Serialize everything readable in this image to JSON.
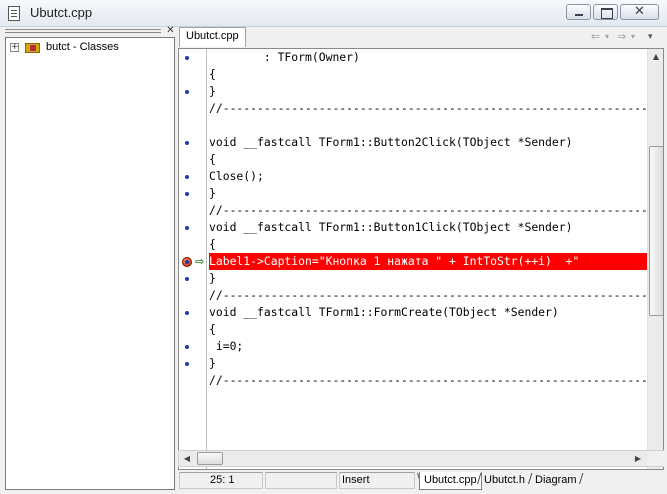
{
  "window": {
    "title": "Ubutct.cpp"
  },
  "class_explorer": {
    "close_glyph": "✕",
    "tree": [
      {
        "expander": "+",
        "label": "butct - Classes"
      }
    ]
  },
  "editor": {
    "tab_label": "Ubutct.cpp",
    "nav": {
      "back": "⇐",
      "back_drop": "▾",
      "forward": "⇒",
      "forward_drop": "▾",
      "menu": "▾"
    },
    "lines": [
      "        : TForm(Owner)",
      "{",
      "}",
      "//---------------------------------------------------------------------",
      "",
      "void __fastcall TForm1::Button2Click(TObject *Sender)",
      "{",
      "Close();",
      "}",
      "//---------------------------------------------------------------------",
      "void __fastcall TForm1::Button1Click(TObject *Sender)",
      "{",
      "Label1->Caption=\"Кнопка 1 нажата \" + IntToStr(++i)  +\"",
      "}",
      "//---------------------------------------------------------------------",
      "void __fastcall TForm1::FormCreate(TObject *Sender)",
      "{",
      " i=0;",
      "}",
      "//---------------------------------------------------------------------"
    ],
    "highlight_color": "#ff0000",
    "gutter_dot_color": "#1c3aa8"
  },
  "statusbar": {
    "position": "25:   1",
    "modified": "",
    "mode": "Insert",
    "tabs": [
      "Ubutct.cpp",
      "Ubutct.h",
      "Diagram"
    ]
  }
}
